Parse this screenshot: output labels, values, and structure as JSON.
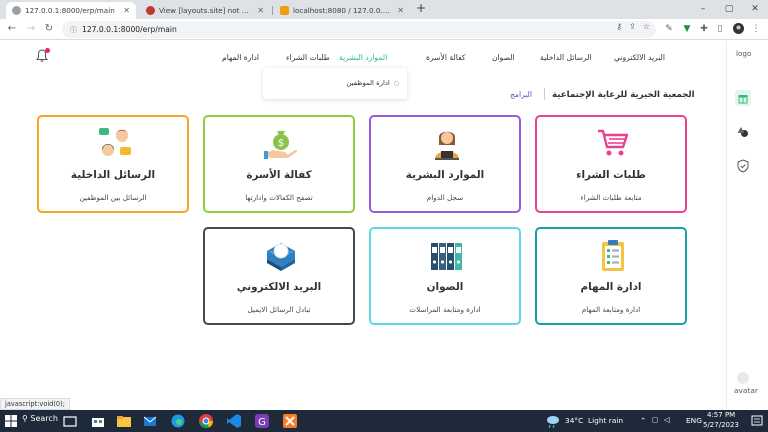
{
  "browser": {
    "tabs": [
      {
        "title": "127.0.0.1:8000/erp/main",
        "active": true
      },
      {
        "title": "View [layouts.site] not found.",
        "active": false
      },
      {
        "title": "localhost:8080 / 127.0.0.1 / dmo",
        "active": false
      }
    ],
    "url": "127.0.0.1:8000/erp/main"
  },
  "nav": {
    "items": [
      "البريد الالكتروني",
      "الرسائل الداخلية",
      "الصوان",
      "كفالة الأسرة",
      "الموارد البشرية",
      "طلبات الشراء",
      "ادارة المهام"
    ],
    "active_index": 4,
    "dropdown_item": "ادارة الموظفين"
  },
  "sidebar": {
    "logo": "logo",
    "avatar": "avatar"
  },
  "breadcrumb": {
    "title": "الجمعية الخيرية للرعاية الإجتماعية",
    "link": "البرامج"
  },
  "cards": [
    {
      "title": "طلبات الشراء",
      "subtitle": "متابعة طلبات الشراء",
      "icon": "cart-icon",
      "color": "#e84393"
    },
    {
      "title": "الموارد البشرية",
      "subtitle": "سجل الدوام",
      "icon": "employee-icon",
      "color": "#9b59e0"
    },
    {
      "title": "كفالة الأسرة",
      "subtitle": "تصفح الكفالات وادارتها",
      "icon": "money-hand-icon",
      "color": "#8bd13c"
    },
    {
      "title": "الرسائل الداخلية",
      "subtitle": "الرسائل بين الموظفين",
      "icon": "chat-people-icon",
      "color": "#f5a623"
    },
    {
      "title": "ادارة المهام",
      "subtitle": "ادارة ومتابعة المهام",
      "icon": "clipboard-icon",
      "color": "#17a2a8"
    },
    {
      "title": "الصوان",
      "subtitle": "ادارة ومتابعة المراسلات",
      "icon": "binders-icon",
      "color": "#5dd6e6"
    },
    {
      "title": "البريد الالكتروني",
      "subtitle": "تبادل الرسائل الايميل",
      "icon": "mailbox-icon",
      "color": "#3c4a55"
    }
  ],
  "statusbar": "javascript:void(0);",
  "taskbar": {
    "search": "Search",
    "weather_temp": "34°C",
    "weather_text": "Light rain",
    "lang": "ENG",
    "time": "4:57 PM",
    "date": "5/27/2023"
  },
  "colors": {
    "accent": "#2dbd7e",
    "link": "#5c4ccc"
  }
}
